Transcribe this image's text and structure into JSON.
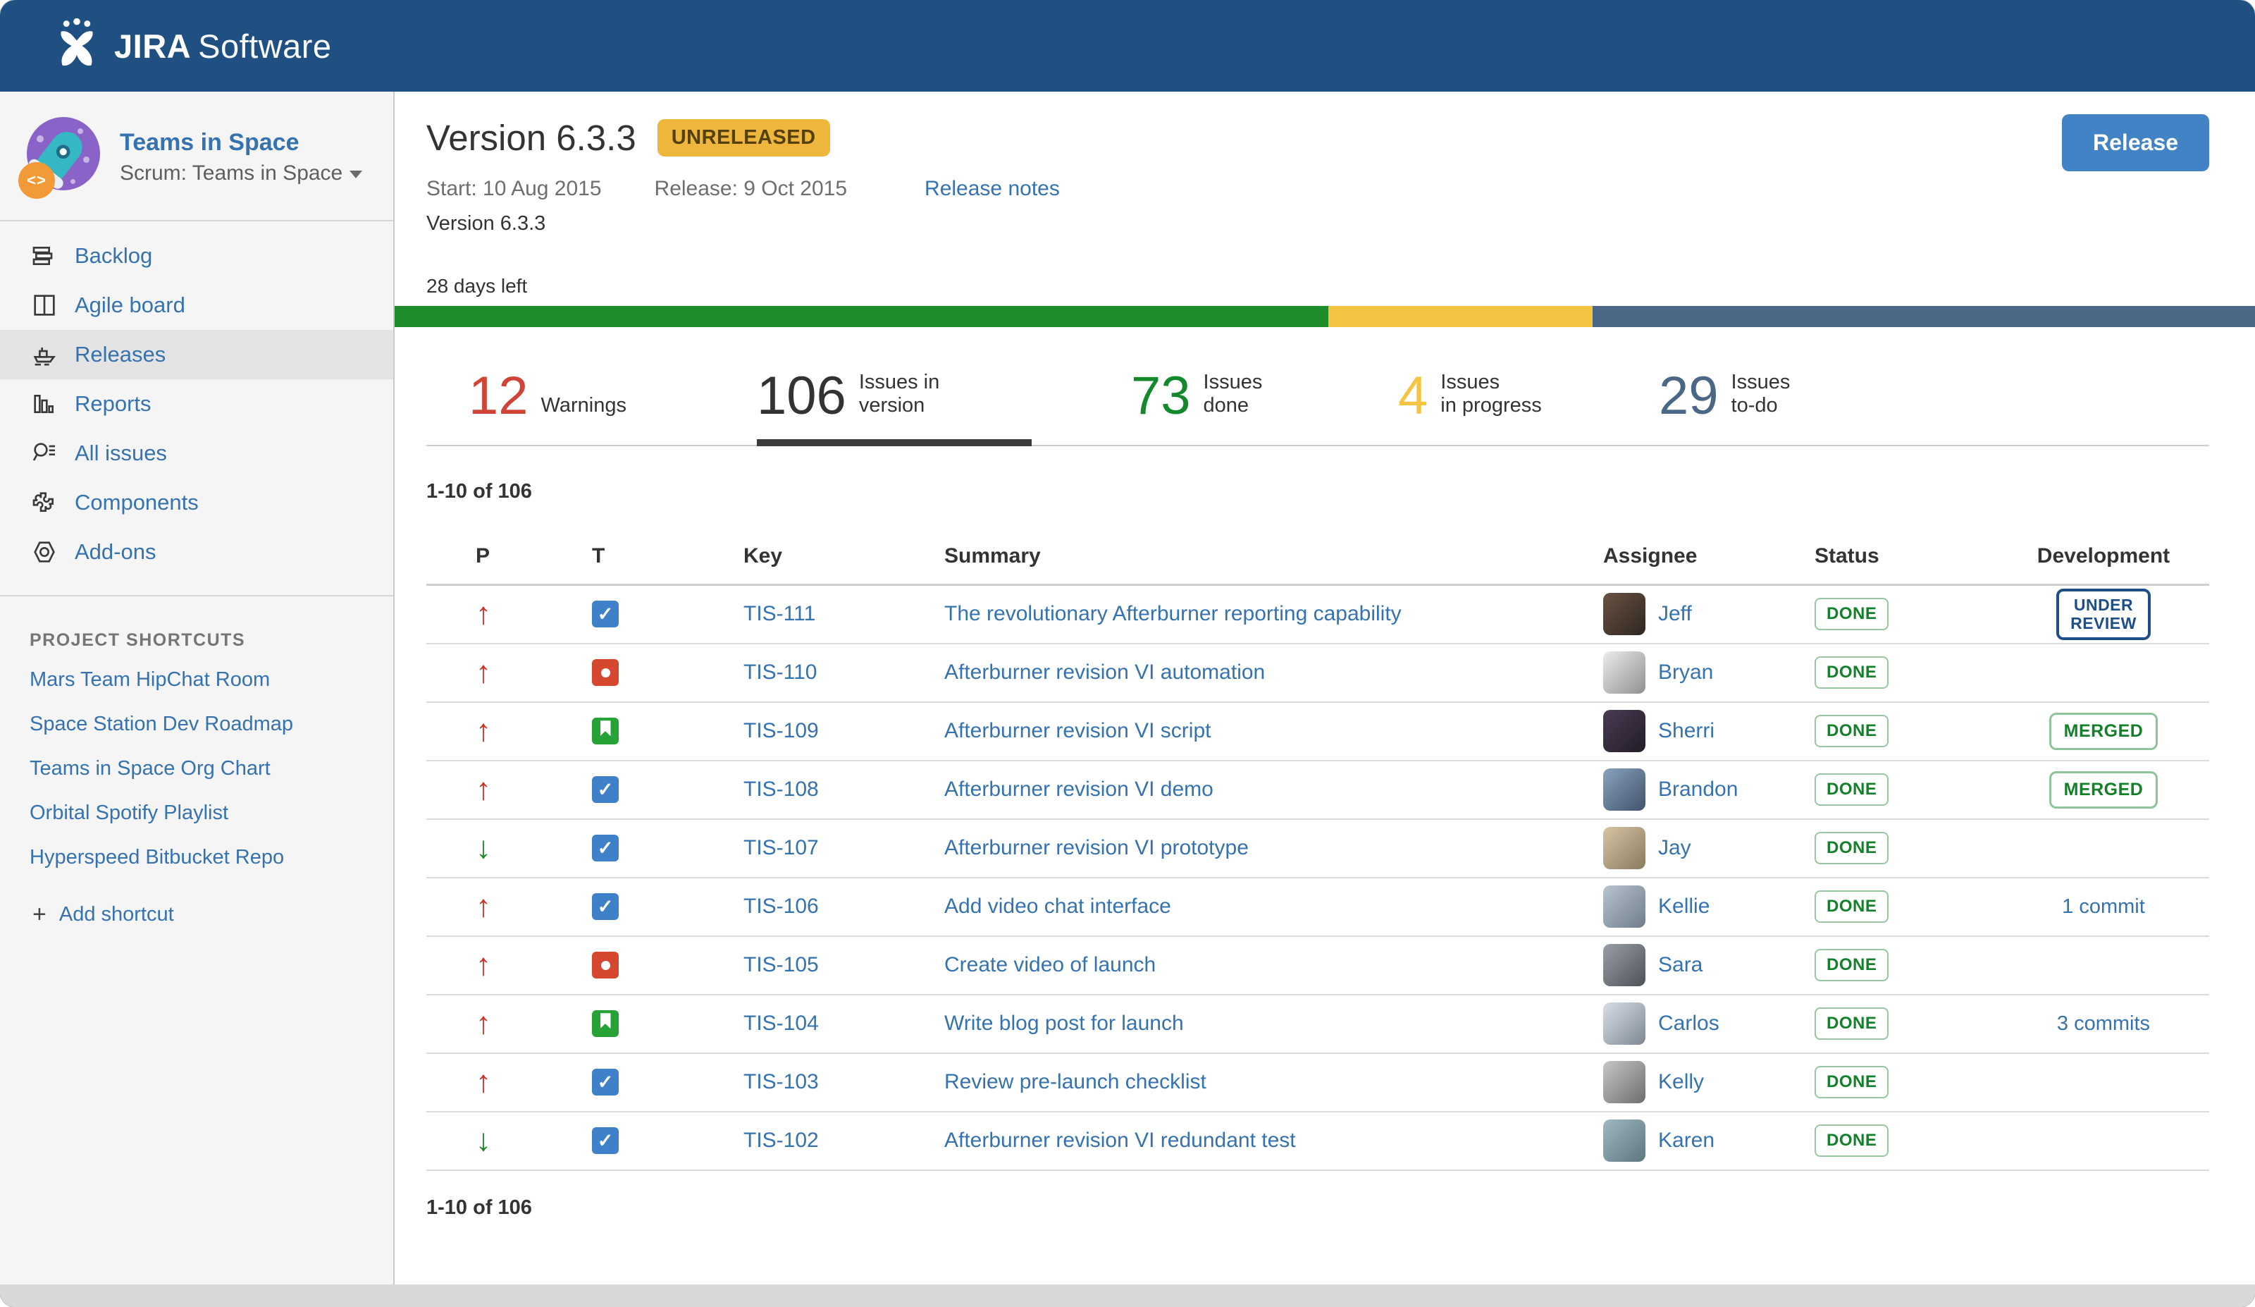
{
  "topbar": {
    "logo_jira": "JIRA",
    "logo_software": "Software"
  },
  "colors": {
    "header_bg": "#205081",
    "link_blue": "#3572b0",
    "green": "#14892c",
    "red": "#d04437",
    "yellow": "#f6c342",
    "slate": "#4a6785",
    "type_task": "#3f81c8",
    "type_bug": "#d5472e",
    "type_story": "#27a236"
  },
  "sidebar": {
    "project": {
      "name": "Teams in Space",
      "board": "Scrum: Teams in Space",
      "badge_glyph": "<>"
    },
    "nav": [
      {
        "label": "Backlog",
        "icon": "backlog-icon",
        "active": false
      },
      {
        "label": "Agile board",
        "icon": "agile-board-icon",
        "active": false
      },
      {
        "label": "Releases",
        "icon": "ship-icon",
        "active": true
      },
      {
        "label": "Reports",
        "icon": "bar-chart-icon",
        "active": false
      },
      {
        "label": "All issues",
        "icon": "search-list-icon",
        "active": false
      },
      {
        "label": "Components",
        "icon": "puzzle-icon",
        "active": false
      },
      {
        "label": "Add-ons",
        "icon": "nut-icon",
        "active": false
      }
    ],
    "shortcuts_title": "PROJECT SHORTCUTS",
    "shortcuts": [
      "Mars Team HipChat Room",
      "Space Station Dev Roadmap",
      "Teams in Space Org Chart",
      "Orbital Spotify Playlist",
      "Hyperspeed Bitbucket Repo"
    ],
    "add_shortcut_label": "Add shortcut",
    "add_shortcut_plus": "+"
  },
  "release": {
    "title": "Version 6.3.3",
    "status_badge": "UNRELEASED",
    "release_button": "Release",
    "start_label": "Start: 10 Aug 2015",
    "release_label": "Release: 9 Oct 2015",
    "release_notes_link": "Release notes",
    "description": "Version 6.3.3",
    "days_left": "28 days left",
    "progress": [
      {
        "name": "done",
        "color": "#1f8c2c",
        "pct": 50.2
      },
      {
        "name": "in-progress",
        "color": "#f5c342",
        "pct": 14.2
      },
      {
        "name": "to-do",
        "color": "#4a6785",
        "pct": 35.6
      }
    ]
  },
  "stats": [
    {
      "value": "12",
      "label_lines": [
        "Warnings"
      ],
      "color": "#d04437",
      "active": false
    },
    {
      "value": "106",
      "label_lines": [
        "Issues in",
        "version"
      ],
      "color": "#333333",
      "active": true
    },
    {
      "value": "73",
      "label_lines": [
        "Issues",
        "done"
      ],
      "color": "#14892c",
      "active": false
    },
    {
      "value": "4",
      "label_lines": [
        "Issues",
        "in progress"
      ],
      "color": "#f6c342",
      "active": false
    },
    {
      "value": "29",
      "label_lines": [
        "Issues",
        "to-do"
      ],
      "color": "#4a6785",
      "active": false
    }
  ],
  "table": {
    "range_top": "1-10 of 106",
    "range_bottom": "1-10 of 106",
    "columns": [
      "P",
      "T",
      "Key",
      "Summary",
      "Assignee",
      "Status",
      "Development"
    ],
    "rows": [
      {
        "priority": "up",
        "type": "task",
        "key": "TIS-111",
        "summary": "The revolutionary Afterburner reporting capability",
        "assignee": "Jeff",
        "avatar_colors": [
          "#6b5243",
          "#2e2620"
        ],
        "status": "DONE",
        "development": {
          "kind": "badge",
          "style": "blue",
          "lines": [
            "UNDER",
            "REVIEW"
          ]
        }
      },
      {
        "priority": "up",
        "type": "bug",
        "key": "TIS-110",
        "summary": "Afterburner revision VI automation",
        "assignee": "Bryan",
        "avatar_colors": [
          "#ececec",
          "#8f8f8f"
        ],
        "status": "DONE",
        "development": {
          "kind": "none"
        }
      },
      {
        "priority": "up",
        "type": "story",
        "key": "TIS-109",
        "summary": "Afterburner revision VI script",
        "assignee": "Sherri",
        "avatar_colors": [
          "#4a3b52",
          "#221c28"
        ],
        "status": "DONE",
        "development": {
          "kind": "badge",
          "style": "green",
          "lines": [
            "MERGED"
          ]
        }
      },
      {
        "priority": "up",
        "type": "task",
        "key": "TIS-108",
        "summary": "Afterburner revision VI demo",
        "assignee": "Brandon",
        "avatar_colors": [
          "#8aa3bd",
          "#41536b"
        ],
        "status": "DONE",
        "development": {
          "kind": "badge",
          "style": "green",
          "lines": [
            "MERGED"
          ]
        }
      },
      {
        "priority": "down",
        "type": "task",
        "key": "TIS-107",
        "summary": "Afterburner revision VI prototype",
        "assignee": "Jay",
        "avatar_colors": [
          "#d6c4a4",
          "#8a7a5e"
        ],
        "status": "DONE",
        "development": {
          "kind": "none"
        }
      },
      {
        "priority": "up",
        "type": "task",
        "key": "TIS-106",
        "summary": "Add video chat interface",
        "assignee": "Kellie",
        "avatar_colors": [
          "#b8c4cf",
          "#6f7d8a"
        ],
        "status": "DONE",
        "development": {
          "kind": "link",
          "label": "1 commit"
        }
      },
      {
        "priority": "up",
        "type": "bug",
        "key": "TIS-105",
        "summary": "Create video of launch",
        "assignee": "Sara",
        "avatar_colors": [
          "#9a9ea6",
          "#4e5258"
        ],
        "status": "DONE",
        "development": {
          "kind": "none"
        }
      },
      {
        "priority": "up",
        "type": "story",
        "key": "TIS-104",
        "summary": "Write blog post for launch",
        "assignee": "Carlos",
        "avatar_colors": [
          "#d8dee6",
          "#7d8894"
        ],
        "status": "DONE",
        "development": {
          "kind": "link",
          "label": "3 commits"
        }
      },
      {
        "priority": "up",
        "type": "task",
        "key": "TIS-103",
        "summary": "Review pre-launch checklist",
        "assignee": "Kelly",
        "avatar_colors": [
          "#c6c6c6",
          "#6e6e6e"
        ],
        "status": "DONE",
        "development": {
          "kind": "none"
        }
      },
      {
        "priority": "down",
        "type": "task",
        "key": "TIS-102",
        "summary": "Afterburner revision VI redundant test",
        "assignee": "Karen",
        "avatar_colors": [
          "#9fb8c2",
          "#5d7680"
        ],
        "status": "DONE",
        "development": {
          "kind": "none"
        }
      }
    ]
  }
}
